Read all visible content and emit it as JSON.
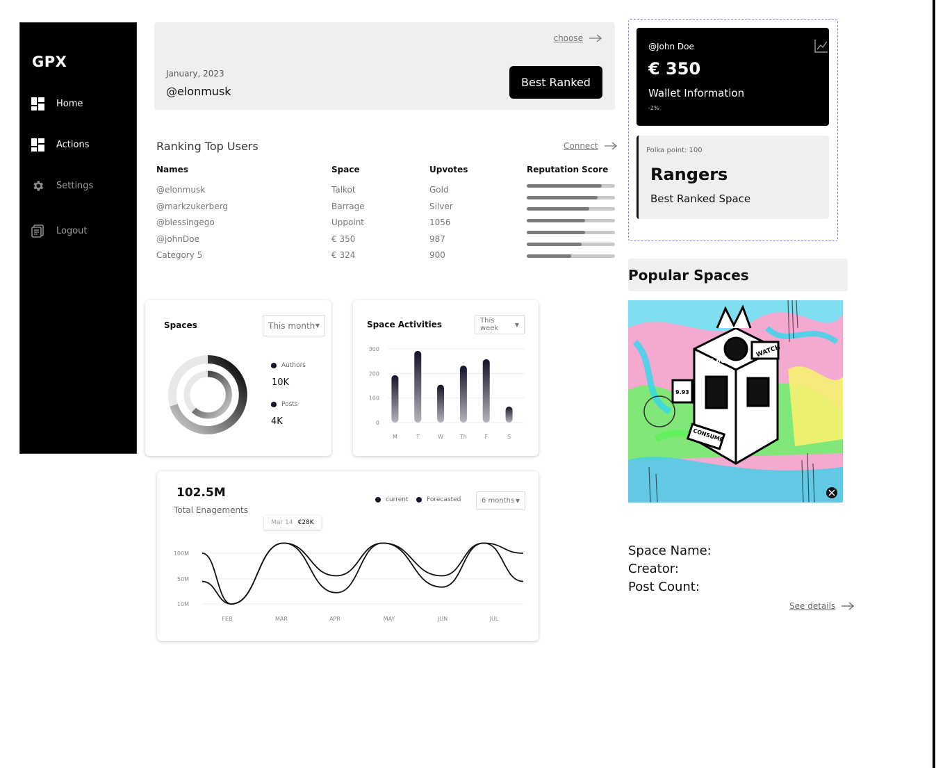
{
  "sidebar": {
    "logo": "GPX",
    "items": [
      {
        "label": "Home",
        "icon": "dashboard-icon"
      },
      {
        "label": "Actions",
        "icon": "dashboard-icon"
      },
      {
        "label": "Settings",
        "icon": "gear-icon"
      },
      {
        "label": "Logout",
        "icon": "document-icon"
      }
    ]
  },
  "banner": {
    "link": "choose",
    "date": "January, 2023",
    "user": "@elonmusk",
    "button": "Best Ranked"
  },
  "ranking": {
    "title": "Ranking Top Users",
    "link": "Connect",
    "headers": [
      "Names",
      "Space",
      "Upvotes",
      "Reputation Score"
    ],
    "rows": [
      {
        "name": "@elonmusk",
        "space": "Talkot",
        "upvotes": "Gold",
        "score": 0.85
      },
      {
        "name": "@markzukerberg",
        "space": "Barrage",
        "upvotes": "Silver",
        "score": 0.8
      },
      {
        "name": "@blessingego",
        "space": "Uppoint",
        "upvotes": "1056",
        "score": 0.71
      },
      {
        "name": "@johnDoe",
        "space": "€ 350",
        "upvotes": "987",
        "score": 0.66
      },
      {
        "name": "Category 5",
        "space": "€ 324",
        "upvotes": "900",
        "score": 0.62
      }
    ],
    "extra_bar_score": 0.5
  },
  "spaces_card": {
    "title": "Spaces",
    "filter": "This month",
    "legend": [
      {
        "label": "Authors",
        "value": "10K"
      },
      {
        "label": "Posts",
        "value": "4K"
      }
    ]
  },
  "activities_card": {
    "title": "Space Activities",
    "filter": "This week"
  },
  "engagement_card": {
    "value": "102.5M",
    "label": "Total Enagements",
    "legend": [
      "current",
      "Forecasted"
    ],
    "filter": "6 months",
    "tooltip_date": "Mar 14",
    "tooltip_value": "€28K"
  },
  "chart_data": [
    {
      "type": "bar",
      "categories": [
        "M",
        "T",
        "W",
        "Th",
        "F",
        "S"
      ],
      "values": [
        193,
        292,
        154,
        232,
        258,
        65
      ],
      "ylim": [
        0,
        300
      ],
      "yticks": [
        0,
        100,
        200,
        300
      ],
      "grid": true
    },
    {
      "type": "line",
      "categories": [
        "FEB",
        "MAR",
        "APR",
        "MAY",
        "JUN",
        "JUL"
      ],
      "yticks": [
        "10M",
        "50M",
        "100M"
      ],
      "series": [
        {
          "name": "current",
          "values": [
            100,
            10,
            118,
            60,
            118,
            60,
            118,
            50
          ]
        },
        {
          "name": "Forecasted",
          "values": [
            50,
            10,
            118,
            30,
            118,
            40,
            118,
            100
          ]
        }
      ]
    }
  ],
  "wallet": {
    "user": "@John Doe",
    "amount": "€ 350",
    "label": "Wallet Information",
    "change": "-2%"
  },
  "rangers": {
    "point": "Polka point: 100",
    "name": "Rangers",
    "subtitle": "Best Ranked Space"
  },
  "popular": {
    "title": "Popular Spaces",
    "meta": [
      "Space Name:",
      "Creator:",
      "Post Count:"
    ],
    "link": "See details",
    "art_words": [
      "WATCH",
      "6.66",
      "9.93",
      "CONSUME"
    ]
  }
}
